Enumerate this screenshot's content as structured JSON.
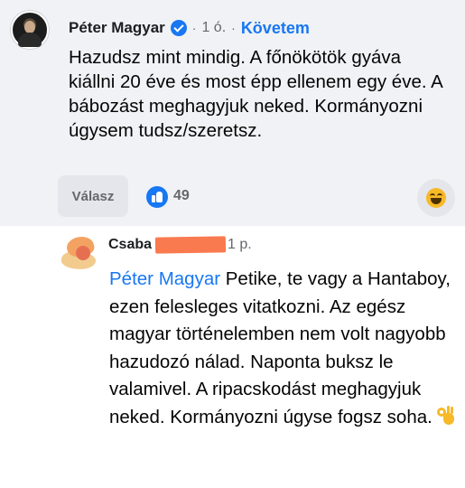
{
  "comment": {
    "author": "Péter Magyar",
    "verified_icon": "verified-badge-icon",
    "separator": "·",
    "time": "1 ó.",
    "follow_label": "Követem",
    "text": "Hazudsz mint mindig. A főnökötök gyáva kiállni 20 éve és most épp ellenem egy éve. A bábozást meghagyjuk neked. Kormányozni úgysem tudsz/szeretsz.",
    "reply_label": "Válasz",
    "like_icon": "like-thumb-icon",
    "like_count": "49",
    "reaction_icon": "laughing-emoji-icon"
  },
  "reply": {
    "author": "Csaba",
    "time": "1 p.",
    "mention": "Péter Magyar",
    "text": " Petike, te vagy a Hantaboy, ezen felesleges vitatkozni. Az egész magyar történelemben nem volt nagyobb hazudozó nálad. Naponta buksz le valamivel. A ripacskodást meghagyjuk neked. Kormányozni úgyse fogsz soha.",
    "emoji_icon": "ok-hand-emoji-icon"
  },
  "colors": {
    "accent": "#1877f2",
    "comment_bg": "#f0f2f5",
    "redaction": "#fa7a4f"
  }
}
